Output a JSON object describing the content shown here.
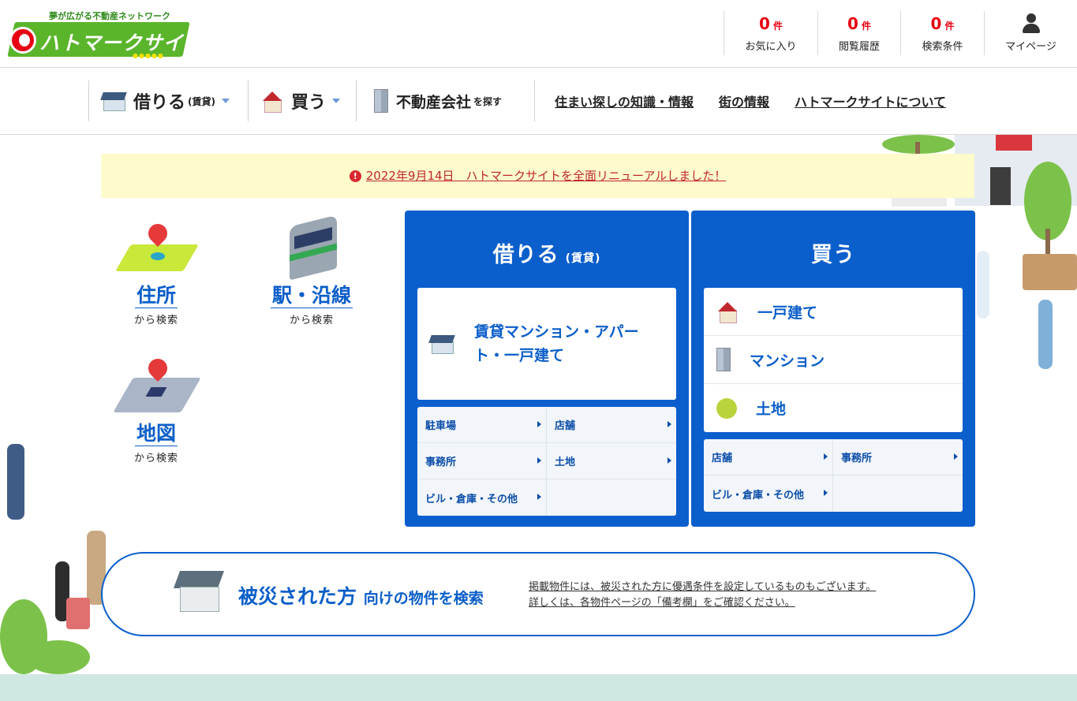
{
  "header": {
    "logo_tagline": "夢が広がる不動産ネットワーク",
    "logo_name": "ハトマークサイト",
    "counters": [
      {
        "num": "0",
        "unit": "件",
        "label": "お気に入り"
      },
      {
        "num": "0",
        "unit": "件",
        "label": "閲覧履歴"
      },
      {
        "num": "0",
        "unit": "件",
        "label": "検索条件"
      }
    ],
    "mypage_label": "マイページ"
  },
  "nav": {
    "rent": {
      "label": "借りる",
      "sub": "(賃貸)"
    },
    "buy": {
      "label": "買う"
    },
    "company": {
      "label": "不動産会社",
      "sub": "を探す"
    },
    "links": [
      "住まい探しの知識・情報",
      "街の情報",
      "ハトマークサイトについて"
    ]
  },
  "notice": {
    "text": "2022年9月14日　ハトマークサイトを全面リニューアルしました！"
  },
  "left_search": {
    "address": {
      "title": "住所",
      "sub": "から検索"
    },
    "station": {
      "title": "駅・沿線",
      "sub": "から検索"
    },
    "map": {
      "title": "地図",
      "sub": "から検索"
    }
  },
  "rent_box": {
    "title": "借りる",
    "title_sub": "(賃貸)",
    "main_label": "賃貸マンション・アパート・一戸建て",
    "sub_items": [
      "駐車場",
      "店舗",
      "事務所",
      "土地",
      "ビル・倉庫・その他"
    ]
  },
  "buy_box": {
    "title": "買う",
    "items": [
      "一戸建て",
      "マンション",
      "土地"
    ],
    "sub_items": [
      "店舗",
      "事務所",
      "ビル・倉庫・その他"
    ]
  },
  "disaster": {
    "title_main": "被災された方",
    "title_rest": "向けの物件を検索",
    "note_1": "掲載物件には、被災された方に優遇条件を設定しているものもございます。",
    "note_2": "詳しくは、各物件ページの「備考欄」をご確認ください。"
  },
  "colors": {
    "brand_green": "#5ab52b",
    "accent_blue": "#0b5fcc",
    "count_red": "#e60012",
    "notice_bg": "#fdfacc"
  }
}
